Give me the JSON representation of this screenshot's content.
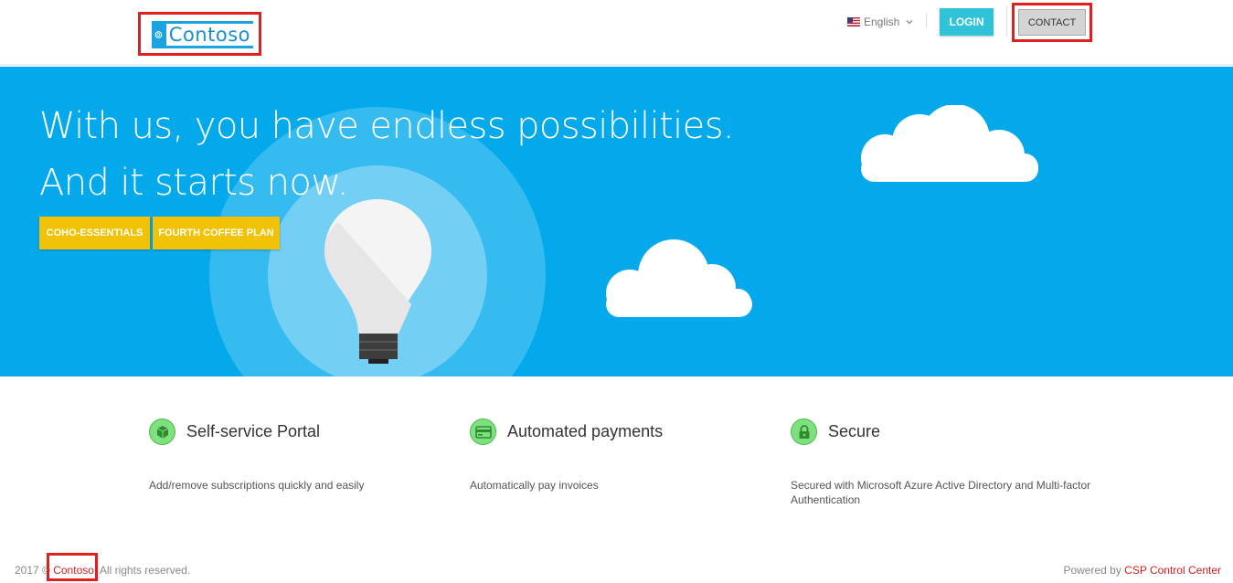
{
  "header": {
    "logo_text": "Contoso",
    "language": "English",
    "login_label": "LOGIN",
    "contact_label": "CONTACT"
  },
  "hero": {
    "title_line1": "With us, you have endless possibilities.",
    "title_line2": "And it starts now.",
    "plans": [
      "COHO-ESSENTIALS",
      "FOURTH COFFEE PLAN"
    ]
  },
  "features": [
    {
      "title": "Self-service Portal",
      "description": "Add/remove subscriptions quickly and easily",
      "icon": "cube-icon"
    },
    {
      "title": "Automated payments",
      "description": "Automatically pay invoices",
      "icon": "credit-card-icon"
    },
    {
      "title": "Secure",
      "description": "Secured with Microsoft Azure Active Directory and Multi-factor Authentication",
      "icon": "lock-icon"
    }
  ],
  "footer": {
    "year": "2017 ©",
    "brand": "Contoso",
    "rights": ". All rights reserved.",
    "powered_by": "Powered by",
    "powered_link": "CSP Control Center"
  },
  "colors": {
    "hero_bg": "#03a9ea",
    "login": "#2fc3d9",
    "plan_button": "#f2c206",
    "feature_icon": "#7ee07e",
    "highlight": "#e02020"
  }
}
